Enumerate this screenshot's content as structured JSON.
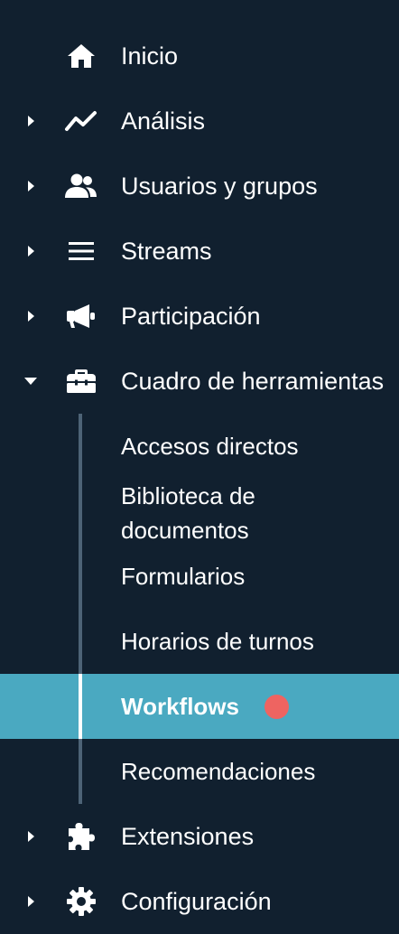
{
  "colors": {
    "background": "#11202f",
    "active_background": "#4aa9c1",
    "tree_line": "#4d6376",
    "notification_dot": "#ee6461",
    "text": "#ffffff"
  },
  "nav": {
    "items": [
      {
        "label": "Inicio",
        "icon": "home-icon",
        "has_caret": false
      },
      {
        "label": "Análisis",
        "icon": "chart-line-icon",
        "has_caret": true,
        "expanded": false
      },
      {
        "label": "Usuarios y grupos",
        "icon": "users-icon",
        "has_caret": true,
        "expanded": false
      },
      {
        "label": "Streams",
        "icon": "menu-lines-icon",
        "has_caret": true,
        "expanded": false
      },
      {
        "label": "Participación",
        "icon": "megaphone-icon",
        "has_caret": true,
        "expanded": false
      },
      {
        "label": "Cuadro de herramientas",
        "icon": "toolbox-icon",
        "has_caret": true,
        "expanded": true
      },
      {
        "label": "Extensiones",
        "icon": "puzzle-icon",
        "has_caret": true,
        "expanded": false
      },
      {
        "label": "Configuración",
        "icon": "gear-icon",
        "has_caret": true,
        "expanded": false
      }
    ],
    "toolbox_sub_items": [
      {
        "label": "Accesos directos",
        "active": false
      },
      {
        "label_line1": "Biblioteca de",
        "label_line2": "documentos",
        "active": false
      },
      {
        "label": "Formularios",
        "active": false
      },
      {
        "label": "Horarios de turnos",
        "active": false
      },
      {
        "label": "Workflows",
        "active": true,
        "has_notification": true
      },
      {
        "label": "Recomendaciones",
        "active": false
      }
    ]
  }
}
